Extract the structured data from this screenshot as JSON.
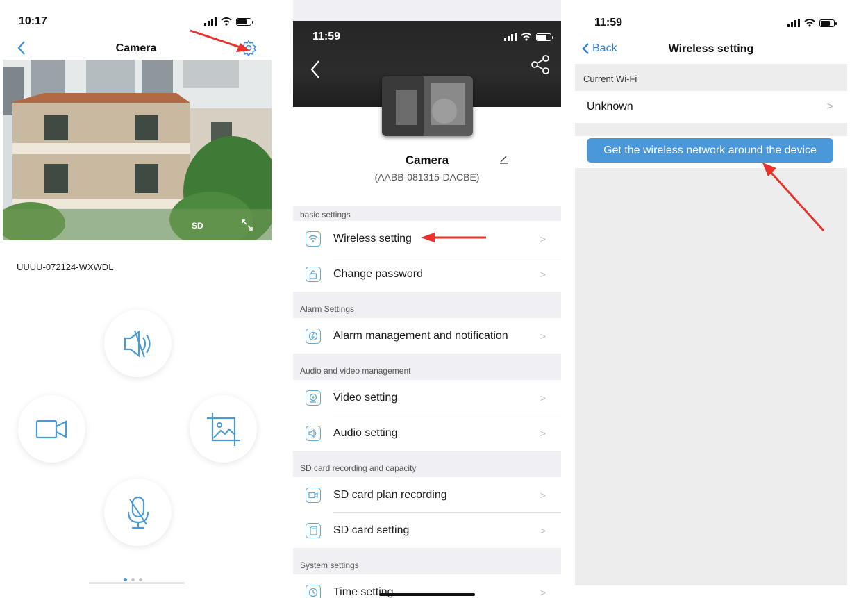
{
  "screen1": {
    "status": {
      "time": "10:17"
    },
    "nav": {
      "title": "Camera"
    },
    "video": {
      "quality": "SD"
    },
    "device_id": "UUUU-072124-WXWDL",
    "controls": [
      "mute-speaker",
      "record-video",
      "snapshot",
      "microphone"
    ],
    "pager": {
      "count": 3,
      "active": 0
    }
  },
  "screen2": {
    "status": {
      "time": "11:59"
    },
    "camera_name": "Camera",
    "camera_id": "(AABB-081315-DACBE)",
    "sections": [
      {
        "header": "basic settings",
        "items": [
          {
            "label": "Wireless setting",
            "icon": "wifi-icon"
          },
          {
            "label": "Change password",
            "icon": "lock-icon"
          }
        ]
      },
      {
        "header": "Alarm Settings",
        "items": [
          {
            "label": "Alarm management and notification",
            "icon": "alarm-icon"
          }
        ]
      },
      {
        "header": "Audio and video management",
        "items": [
          {
            "label": "Video setting",
            "icon": "webcam-icon"
          },
          {
            "label": "Audio setting",
            "icon": "speaker-icon"
          }
        ]
      },
      {
        "header": "SD card recording and capacity",
        "items": [
          {
            "label": "SD card plan recording",
            "icon": "video-record-icon"
          },
          {
            "label": "SD card setting",
            "icon": "sd-card-icon"
          }
        ]
      },
      {
        "header": "System settings",
        "items": [
          {
            "label": "Time setting",
            "icon": "clock-icon"
          }
        ]
      }
    ]
  },
  "screen3": {
    "status": {
      "time": "11:59"
    },
    "back_label": "Back",
    "title": "Wireless setting",
    "current_wifi_header": "Current Wi-Fi",
    "current_wifi_value": "Unknown",
    "scan_button": "Get the wireless network around the device"
  },
  "colors": {
    "accent": "#4a97d9",
    "icon_blue": "#5ea9d9",
    "arrow_red": "#e8322b"
  }
}
